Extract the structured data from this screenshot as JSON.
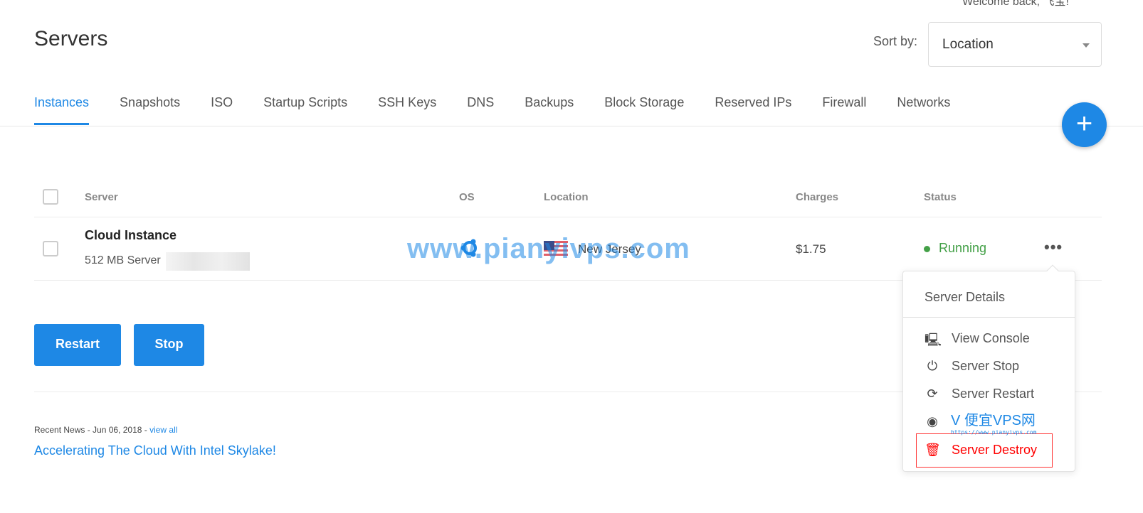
{
  "header": {
    "welcome": "Welcome back, 飞宝!",
    "title": "Servers",
    "sort_label": "Sort by:",
    "sort_value": "Location"
  },
  "tabs": [
    "Instances",
    "Snapshots",
    "ISO",
    "Startup Scripts",
    "SSH Keys",
    "DNS",
    "Backups",
    "Block Storage",
    "Reserved IPs",
    "Firewall",
    "Networks"
  ],
  "active_tab": "Instances",
  "fab": "+",
  "table": {
    "columns": [
      "Server",
      "OS",
      "Location",
      "Charges",
      "Status"
    ],
    "rows": [
      {
        "name": "Cloud Instance",
        "plan": "512 MB Server",
        "os": "ubuntu-icon",
        "location": "New Jersey",
        "flag": "us-flag",
        "charges": "$1.75",
        "status": "Running",
        "more": "•••"
      }
    ]
  },
  "actions": {
    "restart": "Restart",
    "stop": "Stop"
  },
  "news": {
    "prefix": "Recent News - Jun 06, 2018 - ",
    "link": "view all",
    "headline": "Accelerating The Cloud With Intel Skylake!"
  },
  "menu": {
    "details": "Server Details",
    "items": [
      {
        "icon": "console-icon",
        "label": "View Console"
      },
      {
        "icon": "power-icon",
        "label": "Server Stop"
      },
      {
        "icon": "restart-icon",
        "label": "Server Restart"
      },
      {
        "icon": "disc-icon",
        "label": ""
      },
      {
        "icon": "trash-icon",
        "label": "Server Destroy"
      }
    ]
  },
  "watermark": {
    "main": "www.pianyivps.com",
    "logo": "V 便宜VPS网",
    "logo_url": "https://www.pianyivps.com"
  },
  "colors": {
    "accent": "#1e88e5",
    "running": "#43a047",
    "danger": "#ff0000"
  }
}
